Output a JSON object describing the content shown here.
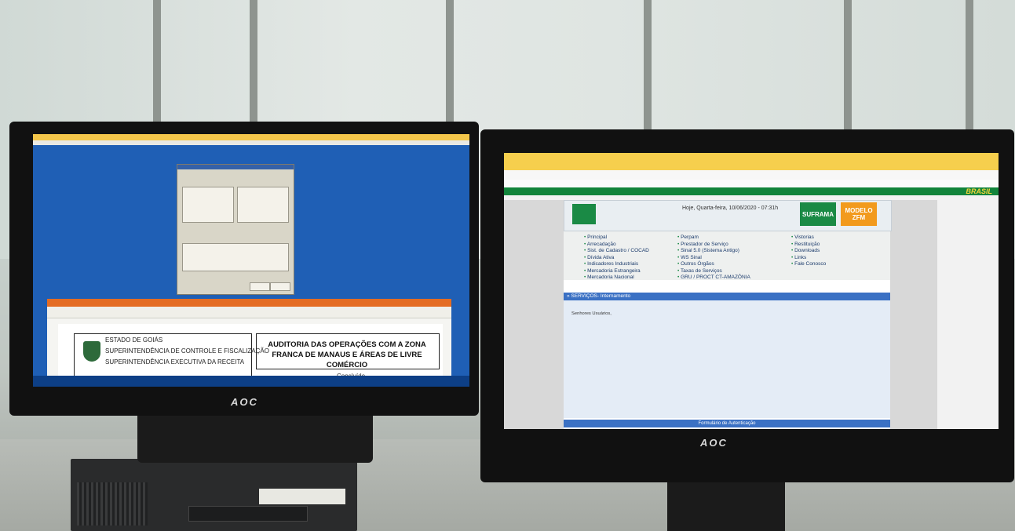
{
  "left_monitor": {
    "brand": "AOC",
    "document": {
      "org_line1": "ESTADO DE GOIÁS",
      "org_line2": "SUPERINTENDÊNCIA DE CONTROLE E FISCALIZAÇÃO",
      "org_line3": "SUPERINTENDÊNCIA EXECUTIVA DA RECEITA",
      "title": "AUDITORIA DAS OPERAÇÕES COM A ZONA FRANCA DE MANAUS E ÁREAS DE LIVRE COMÉRCIO",
      "status": "Concluído"
    }
  },
  "right_monitor": {
    "brand": "AOC",
    "site": {
      "banner": "BRASIL",
      "date": "Hoje, Quarta-feira, 10/06/2020 - 07:31h",
      "buttons": [
        "SUFRAMA",
        "MODELO ZFM"
      ],
      "nav_col1": [
        "Principal",
        "Arrecadação",
        "Sist. de Cadastro / COCAD",
        "Dívida Ativa",
        "Indicadores Industriais",
        "Mercadoria Estrangeira",
        "Mercadoria Nacional"
      ],
      "nav_col2": [
        "Perpam",
        "Prestador de Serviço",
        "Sinal 5.0 (Sistema Antigo)",
        "WS Sinal",
        "Outros Órgãos",
        "Taxas de Serviços",
        "GRU / PROCT CT-AMAZÔNIA"
      ],
      "nav_col3": [
        "Vistorias",
        "Restituição",
        "Downloads",
        "Links",
        "Fale Conosco"
      ],
      "section_title": "» SERVIÇOS- Internamento",
      "greeting": "Senhores Usuários,",
      "form_title": "Formulário de Autenticação"
    }
  },
  "colors": {
    "left_desktop": "#1f5fb5",
    "suframa_green": "#1a8a45",
    "modelo_orange": "#f29a1d",
    "section_blue": "#3b71c4"
  }
}
